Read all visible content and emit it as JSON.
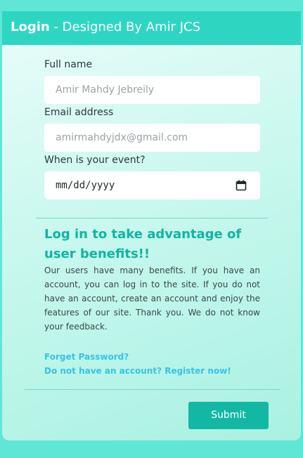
{
  "header": {
    "title_bold": "Login",
    "title_rest": " - Designed By Amir JCS"
  },
  "form": {
    "full_name": {
      "label": "Full name",
      "placeholder": "Amir Mahdy Jebreily"
    },
    "email": {
      "label": "Email address",
      "placeholder": "amirmahdyjdx@gmail.com"
    },
    "event_date": {
      "label": "When is your event?",
      "placeholder": "mm/dd/yyyy"
    }
  },
  "benefits": {
    "heading": "Log in to take advantage of user benefits!!",
    "text": "Our users have many benefits. If you have an account, you can log in to the site. If you do not have an account, create an account and enjoy the features of our site. Thank you. We do not know your feedback."
  },
  "links": {
    "forgot_password": "Forget Password?",
    "register": "Do not have an account? Register now!"
  },
  "actions": {
    "submit_label": "Submit"
  },
  "colors": {
    "page_background": "#5fe6d4",
    "header_background": "#2ed6c2",
    "accent": "#10b5a1",
    "link": "#35c3e6",
    "button": "#13b8a3"
  },
  "icons": {
    "date_picker": "calendar-icon"
  }
}
